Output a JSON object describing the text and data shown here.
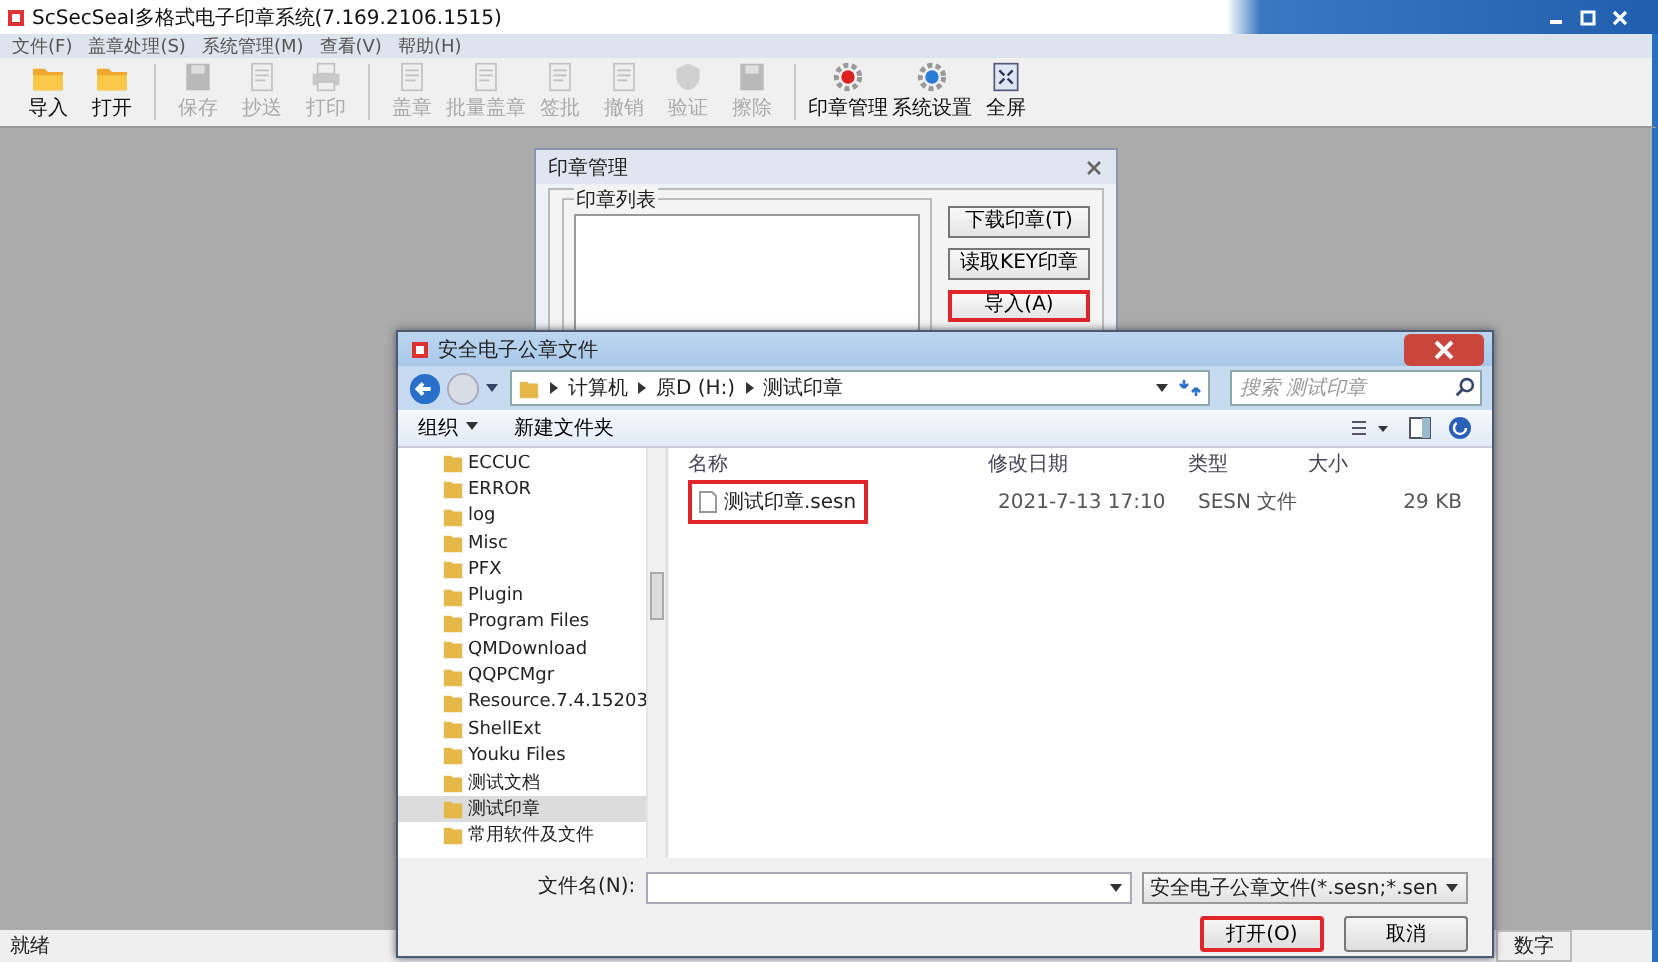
{
  "main_window": {
    "title": "ScSecSeal多格式电子印章系统(7.169.2106.1515)"
  },
  "menu": [
    "文件(F)",
    "盖章处理(S)",
    "系统管理(M)",
    "查看(V)",
    "帮助(H)"
  ],
  "toolbar": [
    [
      {
        "label": "导入",
        "kind": "folder",
        "disabled": false
      },
      {
        "label": "打开",
        "kind": "folder",
        "disabled": false
      }
    ],
    [
      {
        "label": "保存",
        "kind": "disk",
        "disabled": true
      },
      {
        "label": "抄送",
        "kind": "document",
        "disabled": true
      },
      {
        "label": "打印",
        "kind": "printer",
        "disabled": true
      }
    ],
    [
      {
        "label": "盖章",
        "kind": "document",
        "disabled": true
      },
      {
        "label": "批量盖章",
        "kind": "document",
        "disabled": true
      },
      {
        "label": "签批",
        "kind": "document",
        "disabled": true
      },
      {
        "label": "撤销",
        "kind": "document",
        "disabled": true
      },
      {
        "label": "验证",
        "kind": "shield",
        "disabled": true
      },
      {
        "label": "擦除",
        "kind": "disk",
        "disabled": true
      }
    ],
    [
      {
        "label": "印章管理",
        "kind": "gear",
        "disabled": false
      },
      {
        "label": "系统设置",
        "kind": "gear",
        "disabled": false
      },
      {
        "label": "全屏",
        "kind": "screen",
        "disabled": false
      }
    ]
  ],
  "seal_dialog": {
    "title": "印章管理",
    "list_label": "印章列表",
    "buttons": [
      {
        "label": "下载印章(T)",
        "highlighted": false
      },
      {
        "label": "读取KEY印章",
        "highlighted": false
      },
      {
        "label": "导入(A)",
        "highlighted": true
      }
    ]
  },
  "file_dialog": {
    "title": "安全电子公章文件",
    "path": [
      "计算机",
      "原D (H:)",
      "测试印章"
    ],
    "search": {
      "placeholder": "搜索 测试印章"
    },
    "toolbar": [
      "组织",
      "新建文件夹"
    ],
    "tree": [
      {
        "label": "ECCUC",
        "selected": false
      },
      {
        "label": "ERROR",
        "selected": false
      },
      {
        "label": "log",
        "selected": false
      },
      {
        "label": "Misc",
        "selected": false
      },
      {
        "label": "PFX",
        "selected": false
      },
      {
        "label": "Plugin",
        "selected": false
      },
      {
        "label": "Program Files",
        "selected": false
      },
      {
        "label": "QMDownload",
        "selected": false
      },
      {
        "label": "QQPCMgr",
        "selected": false
      },
      {
        "label": "Resource.7.4.15203",
        "selected": false
      },
      {
        "label": "ShellExt",
        "selected": false
      },
      {
        "label": "Youku Files",
        "selected": false
      },
      {
        "label": "测试文档",
        "selected": false
      },
      {
        "label": "测试印章",
        "selected": true
      },
      {
        "label": "常用软件及文件",
        "selected": false
      }
    ],
    "columns": [
      "名称",
      "修改日期",
      "类型",
      "大小"
    ],
    "files": [
      {
        "name": "测试印章.sesn",
        "modified": "2021-7-13 17:10",
        "type": "SESN 文件",
        "size": "29 KB",
        "highlighted": true
      }
    ],
    "filename_label": "文件名(N):",
    "filter": "安全电子公章文件(*.sesn;*.sen",
    "buttons": [
      {
        "label": "打开(O)",
        "highlighted": true
      },
      {
        "label": "取消",
        "highlighted": false
      }
    ]
  },
  "status_bar": {
    "text": "就绪",
    "indicators": [
      "数字"
    ]
  }
}
